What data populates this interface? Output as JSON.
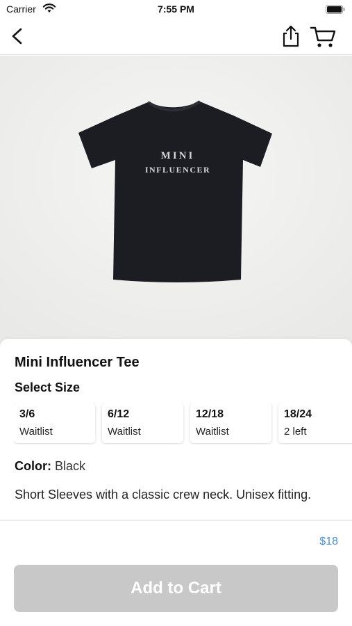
{
  "status_bar": {
    "carrier": "Carrier",
    "time": "7:55 PM"
  },
  "nav": {
    "icons": [
      "back-chevron-icon",
      "share-icon",
      "cart-icon"
    ]
  },
  "product": {
    "image_text_top": "MINI",
    "image_text_bottom": "INFLUENCER",
    "title": "Mini Influencer Tee",
    "size_heading": "Select Size",
    "sizes": [
      {
        "label": "3/6",
        "status": "Waitlist"
      },
      {
        "label": "6/12",
        "status": "Waitlist"
      },
      {
        "label": "12/18",
        "status": "Waitlist"
      },
      {
        "label": "18/24",
        "status": "2 left"
      }
    ],
    "color_label": "Color:",
    "color_value": "Black",
    "description": "Short Sleeves with a classic crew neck. Unisex fitting."
  },
  "footer": {
    "price": "$18",
    "add_to_cart_label": "Add to Cart"
  },
  "colors": {
    "price_accent": "#4a90d9",
    "button_disabled": "#c8c8c8",
    "tee": "#1b1d22"
  }
}
